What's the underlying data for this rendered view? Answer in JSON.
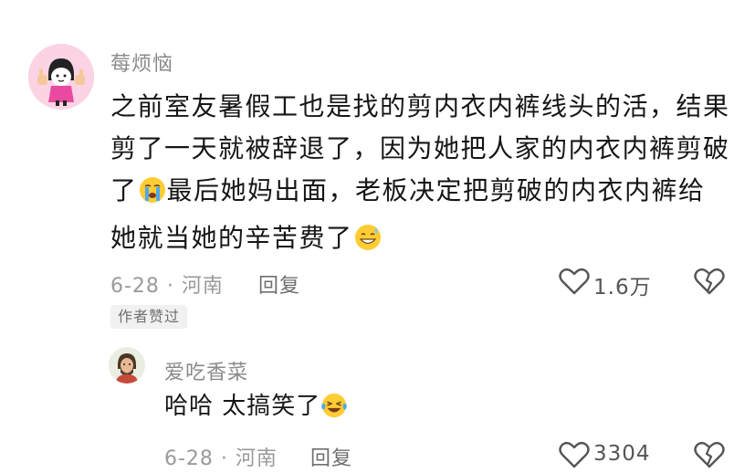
{
  "comment": {
    "username": "莓烦恼",
    "text_lines": [
      "之前室友暑假工也是找的剪内衣内裤线头的活，结果",
      "剪了一天就被辞退了，因为她把人家的内衣内裤剪破",
      "最后她妈出面，老板决定把剪破的内衣内裤给",
      "她就当她的辛苦费了"
    ],
    "line3_prefix": "了",
    "emoji_crying": "crying-face-emoji",
    "emoji_grin": "grinning-sweat-emoji",
    "meta": "6-28 · 河南",
    "reply_label": "回复",
    "like_count": "1.6万",
    "author_badge": "作者赞过",
    "icons": {
      "like": "heart-icon",
      "dislike": "broken-heart-icon"
    }
  },
  "reply": {
    "username": "爱吃香菜",
    "text": "哈哈 太搞笑了",
    "emoji": "laughing-tears-emoji",
    "meta": "6-28 · 河南",
    "reply_label": "回复",
    "like_count": "3304"
  },
  "colors": {
    "text": "#161616",
    "meta": "#9a9a9a",
    "username": "#8a8a8a"
  }
}
